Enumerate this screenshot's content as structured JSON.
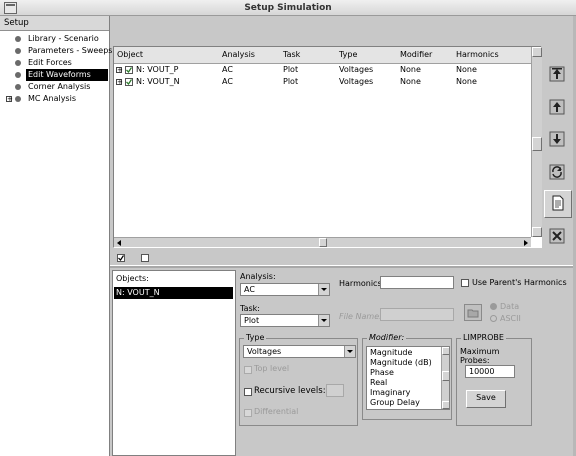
{
  "window": {
    "title": "Setup Simulation"
  },
  "setup": {
    "header": "Setup",
    "items": [
      {
        "label": "Library - Scenario"
      },
      {
        "label": "Parameters - Sweeps"
      },
      {
        "label": "Edit Forces"
      },
      {
        "label": "Edit Waveforms"
      },
      {
        "label": "Corner Analysis"
      },
      {
        "label": "MC Analysis"
      }
    ],
    "selected": "Edit Waveforms"
  },
  "table": {
    "columns": [
      "Object",
      "Analysis",
      "Task",
      "Type",
      "Modifier",
      "Harmonics"
    ],
    "rows": [
      {
        "object": "N: VOUT_P",
        "analysis": "AC",
        "task": "Plot",
        "type": "Voltages",
        "modifier": "None",
        "harmonics": "None"
      },
      {
        "object": "N: VOUT_N",
        "analysis": "AC",
        "task": "Plot",
        "type": "Voltages",
        "modifier": "None",
        "harmonics": "None"
      }
    ]
  },
  "objects": {
    "label": "Objects:",
    "items": [
      "N: VOUT_N"
    ]
  },
  "form": {
    "analysis_label": "Analysis:",
    "analysis_value": "AC",
    "harmonics_label": "Harmonics:",
    "harmonics_value": "",
    "use_parent_label": "Use Parent's Harmonics",
    "task_label": "Task:",
    "task_value": "Plot",
    "file_name_label": "File Name:",
    "data_label": "Data",
    "ascii_label": "ASCII",
    "type_legend": "Type",
    "type_value": "Voltages",
    "top_level_label": "Top level",
    "recursive_label": "Recursive levels:",
    "differential_label": "Differential",
    "modifier_legend": "Modifier:",
    "modifier_options": [
      "Magnitude",
      "Magnitude (dB)",
      "Phase",
      "Real",
      "Imaginary",
      "Group Delay"
    ],
    "limprobe_legend": "LIMPROBE",
    "max_probes_label": "Maximum Probes:",
    "max_probes_value": "10000",
    "save_label": "Save"
  },
  "icons": [
    "move-top-icon",
    "move-up-icon",
    "move-down-icon",
    "refresh-icon",
    "document-icon",
    "delete-icon"
  ]
}
